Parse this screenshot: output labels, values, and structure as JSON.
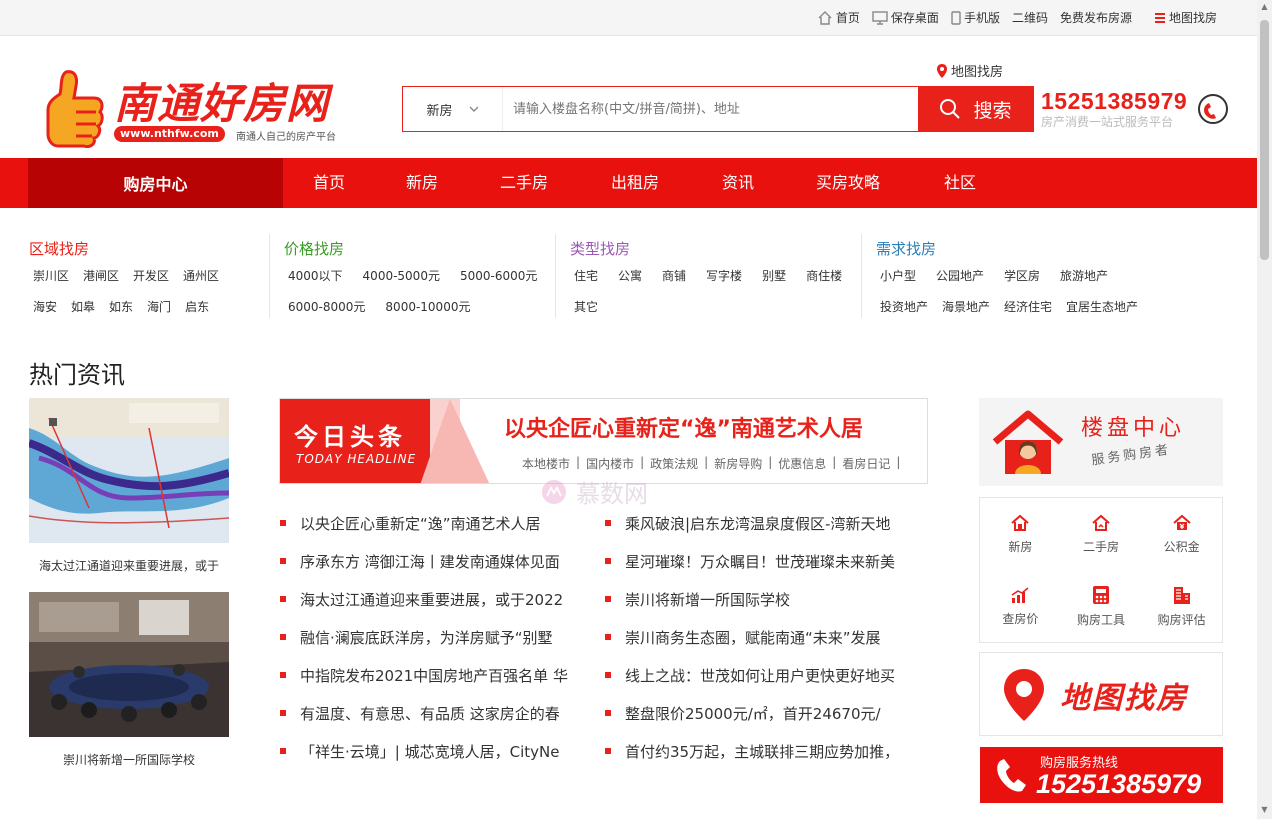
{
  "topbar": {
    "items": [
      "首页",
      "保存桌面",
      "手机版",
      "二维码",
      "免费发布房源",
      "地图找房"
    ]
  },
  "logo": {
    "brand": "南通好房网",
    "url": "www.nthfw.com",
    "slogan": "南通人自己的房产平台"
  },
  "header": {
    "map_find": "地图找房",
    "search_type": "新房",
    "search_placeholder": "请输入楼盘名称(中文/拼音/简拼)、地址",
    "search_button": "搜索",
    "hotline": "15251385979",
    "hotline_sub": "房产消费一站式服务平台"
  },
  "nav": {
    "center": "购房中心",
    "links": [
      "首页",
      "新房",
      "二手房",
      "出租房",
      "资讯",
      "买房攻略",
      "社区"
    ]
  },
  "filters": {
    "region": {
      "title": "区域找房",
      "row1": [
        "崇川区",
        "港闸区",
        "开发区",
        "通州区"
      ],
      "row2": [
        "海安",
        "如皋",
        "如东",
        "海门",
        "启东"
      ]
    },
    "price": {
      "title": "价格找房",
      "row1": [
        "4000以下",
        "4000-5000元",
        "5000-6000元"
      ],
      "row2": [
        "6000-8000元",
        "8000-10000元"
      ]
    },
    "type": {
      "title": "类型找房",
      "row1": [
        "住宅",
        "公寓",
        "商铺",
        "写字楼",
        "别墅",
        "商住楼"
      ],
      "row2": [
        "其它"
      ]
    },
    "need": {
      "title": "需求找房",
      "row1": [
        "小户型",
        "公园地产",
        "学区房",
        "旅游地产"
      ],
      "row2": [
        "投资地产",
        "海景地产",
        "经济住宅",
        "宜居生态地产"
      ]
    }
  },
  "news": {
    "section_title": "热门资讯",
    "captions": [
      "海太过江通道迎来重要进展，或于",
      "崇川将新增一所国际学校"
    ],
    "banner": {
      "label": "今日头条",
      "label_en": "TODAY HEADLINE",
      "headline": "以央企匠心重新定“逸”南通艺术人居",
      "tags": [
        "本地楼市",
        "国内楼市",
        "政策法规",
        "新房导购",
        "优惠信息",
        "看房日记"
      ]
    },
    "left": [
      "以央企匠心重新定“逸”南通艺术人居",
      "序承东方 湾御江海丨建发南通媒体见面",
      "海太过江通道迎来重要进展，或于2022",
      "融信·澜宸底跃洋房，为洋房赋予“别墅",
      "中指院发布2021中国房地产百强名单 华",
      "有温度、有意思、有品质 这家房企的春",
      "「祥生·云境」| 城芯宽境人居，CityNe"
    ],
    "right": [
      "乘风破浪|启东龙湾温泉度假区-湾新天地",
      "星河璀璨！万众瞩目！世茂璀璨未来新美",
      "崇川将新增一所国际学校",
      "崇川商务生态圈，赋能南通“未来”发展",
      "线上之战：世茂如何让用户更快更好地买",
      "整盘限价25000元/㎡，首开24670元/",
      "首付约35万起，主城联排三期应势加推，"
    ],
    "watermark": "慕数网"
  },
  "sidebar": {
    "loupan_title": "楼盘中心",
    "loupan_sub": "服务购房者",
    "tools": [
      "新房",
      "二手房",
      "公积金",
      "查房价",
      "购房工具",
      "购房评估"
    ],
    "map_text": "地图找房",
    "hotline_label": "购房服务热线",
    "hotline_num": "15251385979"
  },
  "colors": {
    "brand_red": "#e8211a",
    "nav_red": "#e8110e",
    "nav_dark": "#b70303",
    "region": "#e8211a",
    "price": "#3a9d23",
    "type": "#9b59b6",
    "need": "#2a7fb8"
  }
}
